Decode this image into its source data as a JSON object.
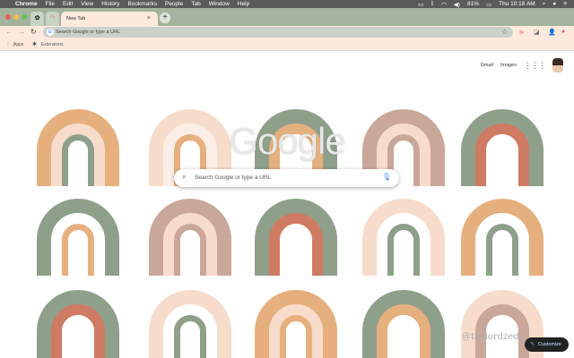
{
  "menubar": {
    "apple_icon": "apple-icon",
    "items": [
      "Chrome",
      "File",
      "Edit",
      "View",
      "History",
      "Bookmarks",
      "People",
      "Tab",
      "Window",
      "Help"
    ],
    "battery": "81%",
    "clock": "Thu 10:18 AM"
  },
  "tabs": {
    "active_title": "New Tab",
    "close_label": "×",
    "new_tab_label": "+"
  },
  "toolbar": {
    "omnibox_placeholder": "Search Google or type a URL"
  },
  "bookmarks": {
    "items": [
      "Apps",
      "Extensions"
    ]
  },
  "ntp": {
    "gmail": "Gmail",
    "images": "Images",
    "logo": "Google",
    "search_placeholder": "Search Google or type a URL",
    "watermark": "@taylordzedu",
    "customize": "Customize"
  },
  "colors": {
    "sage": "#8fa08a",
    "terracotta": "#cf7a63",
    "peach": "#e6b07e",
    "blush": "#f7dccc",
    "mauve": "#c9a899",
    "paleblue": "#d7e3df",
    "tabstrip": "#a4b39e",
    "toolbar": "#fde9de"
  }
}
